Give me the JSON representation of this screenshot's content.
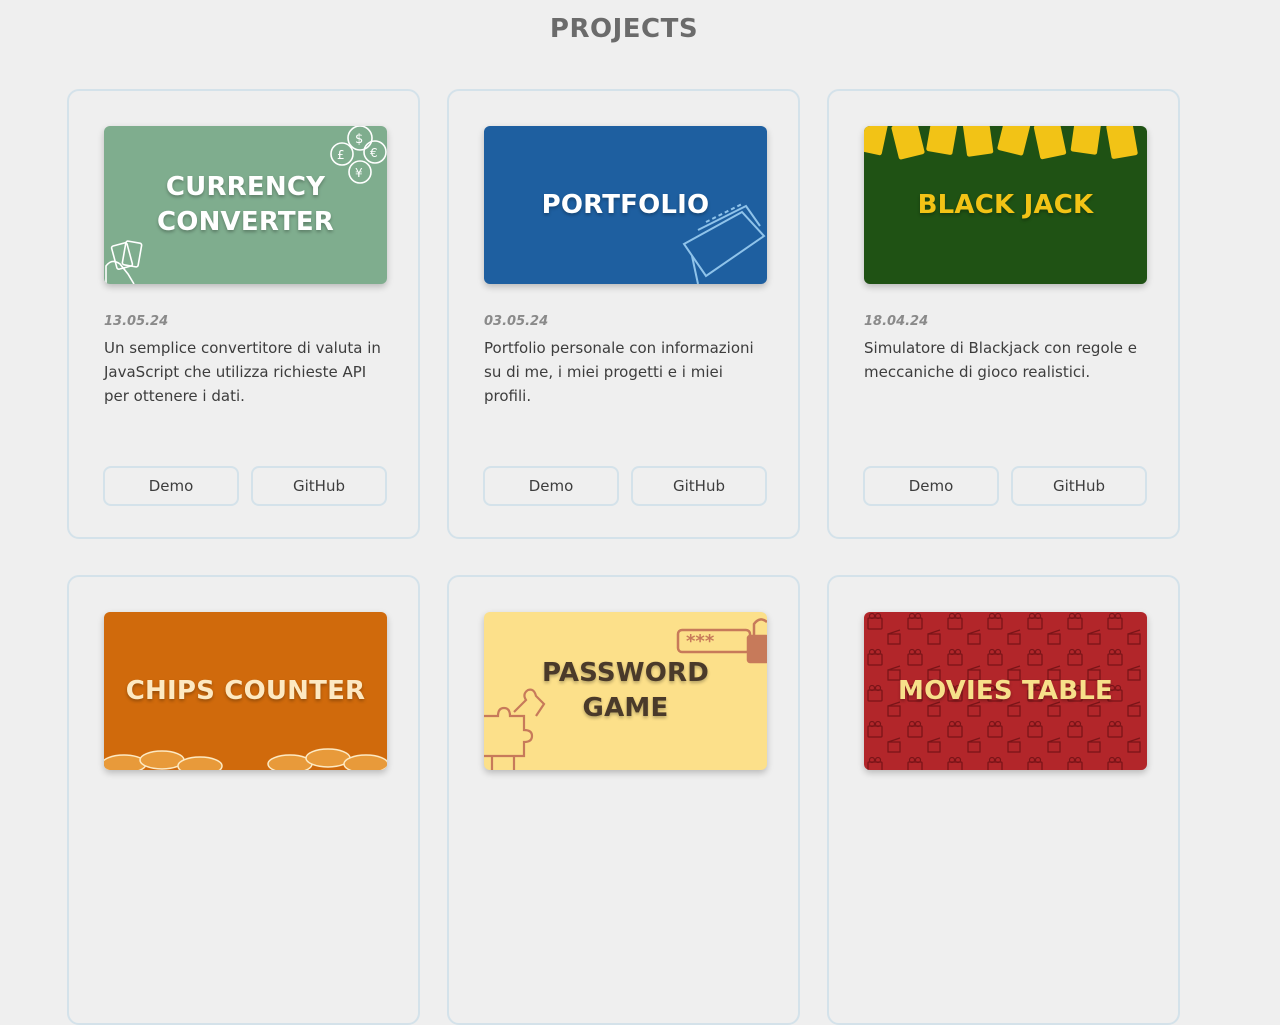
{
  "page": {
    "title": "PROJECTS"
  },
  "projects": [
    {
      "thumb_title": "CURRENCY CONVERTER",
      "date": "13.05.24",
      "description": "Un semplice convertitore di valuta in JavaScript che utilizza richieste API per ottenere i dati.",
      "demo_label": "Demo",
      "github_label": "GitHub",
      "thumb_bg": "#7fad8e",
      "thumb_fg": "#ffffff"
    },
    {
      "thumb_title": "PORTFOLIO",
      "date": "03.05.24",
      "description": "Portfolio personale con informazioni su di me, i miei progetti e i miei profili.",
      "demo_label": "Demo",
      "github_label": "GitHub",
      "thumb_bg": "#1e5fa0",
      "thumb_fg": "#ffffff"
    },
    {
      "thumb_title": "BLACK JACK",
      "date": "18.04.24",
      "description": "Simulatore di Blackjack con regole e meccaniche di gioco realistici.",
      "demo_label": "Demo",
      "github_label": "GitHub",
      "thumb_bg": "#1f5214",
      "thumb_fg": "#f2c316"
    },
    {
      "thumb_title": "CHIPS COUNTER",
      "thumb_bg": "#d06a0c",
      "thumb_fg": "#fde9c2"
    },
    {
      "thumb_title": "PASSWORD GAME",
      "thumb_bg": "#fce08a",
      "thumb_fg": "#4a3a2a"
    },
    {
      "thumb_title": "MOVIES TABLE",
      "thumb_bg": "#b2262a",
      "thumb_fg": "#f7e08a"
    }
  ]
}
